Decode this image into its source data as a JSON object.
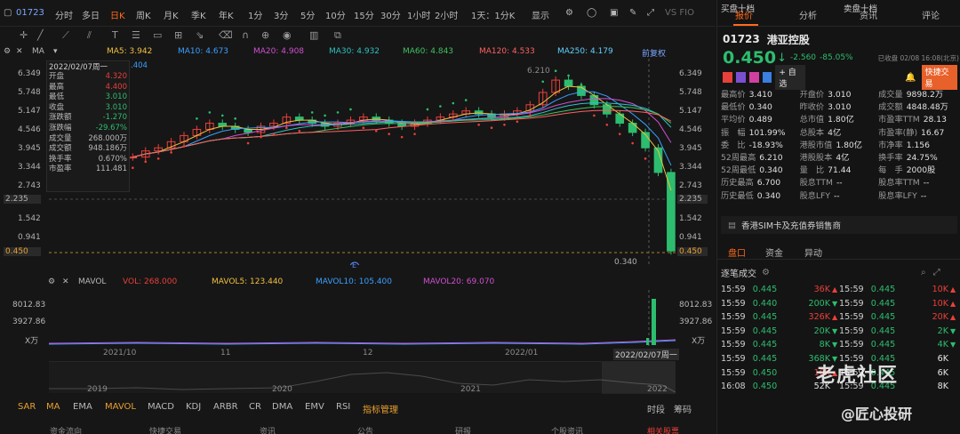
{
  "topbar": {
    "code": "01723",
    "periods": [
      "分时",
      "多日",
      "日K",
      "周K",
      "月K",
      "季K",
      "年K",
      "1分",
      "3分",
      "5分",
      "10分",
      "15分",
      "30分",
      "1小时",
      "2小时"
    ],
    "active_period": "日K",
    "range": "1天：1分K",
    "display": "显示",
    "brand": "VS FIO"
  },
  "ma": {
    "label": "MA",
    "ma5": "MA5: 3.942",
    "ma10": "MA10: 4.673",
    "ma20": "MA20: 4.908",
    "ma30": "MA30: 4.932",
    "ma60": "MA60: 4.843",
    "ma120": "MA120: 4.533",
    "ma250": "MA250: 4.179",
    "adjust": "前复权",
    "overlay_value": ".404"
  },
  "price_axis": [
    "6.349",
    "5.748",
    "5.147",
    "4.546",
    "3.945",
    "3.344",
    "2.743",
    "2.235",
    "1.542",
    "0.941",
    "0.450"
  ],
  "chart_labels": {
    "high": "6.210",
    "low": "0.340",
    "event": "E"
  },
  "infopanel": {
    "date": "2022/02/07周一",
    "rows": [
      {
        "k": "开盘",
        "v": "4.320"
      },
      {
        "k": "最高",
        "v": "4.400"
      },
      {
        "k": "最低",
        "v": "3.010"
      },
      {
        "k": "收盘",
        "v": "3.010"
      },
      {
        "k": "涨跌额",
        "v": "-1.270"
      },
      {
        "k": "涨跌幅",
        "v": "-29.67%"
      },
      {
        "k": "成交量",
        "v": "268.000万"
      },
      {
        "k": "成交额",
        "v": "948.186万"
      },
      {
        "k": "换手率",
        "v": "0.670%"
      },
      {
        "k": "市盈率",
        "v": "111.481"
      }
    ]
  },
  "mavol": {
    "label": "MAVOL",
    "vol": "VOL: 268.000",
    "mavol5": "MAVOL5: 123.440",
    "mavol10": "MAVOL10: 105.400",
    "mavol20": "MAVOL20: 69.070",
    "axis": [
      "8012.83",
      "3927.86",
      "X万"
    ]
  },
  "dates": [
    "2021/10",
    "11",
    "12",
    "2022/01",
    "2022/02/07周一"
  ],
  "years": [
    "2019",
    "2020",
    "2021",
    "2022"
  ],
  "indicators": [
    "SAR",
    "MA",
    "EMA",
    "MAVOL",
    "MACD",
    "KDJ",
    "ARBR",
    "CR",
    "DMA",
    "EMV",
    "RSI",
    "指标管理",
    "时段",
    "筹码"
  ],
  "bottom_tabs": [
    "资金流向",
    "快捷交易",
    "资讯",
    "公告",
    "研报",
    "个股资讯",
    "相关股票"
  ],
  "chart_data": {
    "type": "line",
    "title": "",
    "price_range": [
      0.34,
      6.349
    ],
    "series": [
      {
        "name": "收盘",
        "values": [
          3.5,
          3.7,
          3.8,
          4.0,
          4.2,
          4.4,
          4.6,
          4.5,
          4.4,
          4.3,
          4.5,
          4.6,
          4.8,
          4.7,
          4.6,
          4.5,
          4.6,
          4.7,
          4.8,
          4.7,
          4.6,
          4.5,
          4.6,
          4.7,
          4.8,
          4.9,
          5.0,
          4.9,
          4.8,
          4.9,
          5.0,
          5.2,
          5.6,
          6.0,
          5.8,
          5.5,
          5.2,
          4.9,
          4.6,
          4.3,
          3.8,
          3.0,
          0.45
        ]
      }
    ]
  },
  "right": {
    "tabs": [
      "报价",
      "分析",
      "资讯",
      "评论"
    ],
    "code": "01723",
    "name": "港亚控股",
    "price": "0.450",
    "arrow": "↓",
    "change": "-2.560",
    "change_pct": "-85.05%",
    "close_note": "已收盘 02/08 16:08(北京)",
    "quick_trade": "快捷交易",
    "watch": "自选",
    "stats": [
      [
        {
          "k": "最高价",
          "v": "3.410",
          "c": "red"
        },
        {
          "k": "开盘价",
          "v": "3.010",
          "c": "white"
        },
        {
          "k": "成交量",
          "v": "9898.2万",
          "c": "white"
        }
      ],
      [
        {
          "k": "最低价",
          "v": "0.340",
          "c": "green"
        },
        {
          "k": "昨收价",
          "v": "3.010",
          "c": "white"
        },
        {
          "k": "成交额",
          "v": "4848.48万",
          "c": "white"
        }
      ],
      [
        {
          "k": "平均价",
          "v": "0.489",
          "c": "green"
        },
        {
          "k": "总市值",
          "v": "1.80亿",
          "c": "white"
        },
        {
          "k": "市盈率TTM",
          "v": "28.13",
          "c": "white"
        }
      ],
      [
        {
          "k": "振　幅",
          "v": "101.99%",
          "c": "white"
        },
        {
          "k": "总股本",
          "v": "4亿",
          "c": "white"
        },
        {
          "k": "市盈率(静)",
          "v": "16.67",
          "c": "white"
        }
      ],
      [
        {
          "k": "委　比",
          "v": "-18.93%",
          "c": "white"
        },
        {
          "k": "港股市值",
          "v": "1.80亿",
          "c": "white"
        },
        {
          "k": "市净率",
          "v": "1.156",
          "c": "white"
        }
      ],
      [
        {
          "k": "52周最高",
          "v": "6.210",
          "c": "red"
        },
        {
          "k": "港股股本",
          "v": "4亿",
          "c": "white"
        },
        {
          "k": "换手率",
          "v": "24.75%",
          "c": "white"
        }
      ],
      [
        {
          "k": "52周最低",
          "v": "0.340",
          "c": "green"
        },
        {
          "k": "量　比",
          "v": "71.44",
          "c": "white"
        },
        {
          "k": "每　手",
          "v": "2000股",
          "c": "white"
        }
      ],
      [
        {
          "k": "历史最高",
          "v": "6.700",
          "c": "red"
        },
        {
          "k": "股息TTM",
          "v": "--",
          "c": "white"
        },
        {
          "k": "股息率TTM",
          "v": "--",
          "c": "white"
        }
      ],
      [
        {
          "k": "历史最低",
          "v": "0.340",
          "c": "green"
        },
        {
          "k": "股息LFY",
          "v": "--",
          "c": "white"
        },
        {
          "k": "股息率LFY",
          "v": "--",
          "c": "white"
        }
      ]
    ],
    "promo": "香港SIM卡及充值券销售商",
    "subtabs": [
      "盘口",
      "资金",
      "异动"
    ],
    "ticks_title": "逐笔成交",
    "ticks": [
      [
        {
          "t": "15:59",
          "p": "0.445",
          "v": "36K",
          "c": "red",
          "a": "▲"
        },
        {
          "t": "15:59",
          "p": "0.445",
          "v": "10K",
          "c": "red",
          "a": "▲"
        }
      ],
      [
        {
          "t": "15:59",
          "p": "0.440",
          "v": "200K",
          "c": "green",
          "a": "▼"
        },
        {
          "t": "15:59",
          "p": "0.445",
          "v": "10K",
          "c": "red",
          "a": "▲"
        }
      ],
      [
        {
          "t": "15:59",
          "p": "0.445",
          "v": "326K",
          "c": "red",
          "a": "▲"
        },
        {
          "t": "15:59",
          "p": "0.445",
          "v": "20K",
          "c": "red",
          "a": "▲"
        }
      ],
      [
        {
          "t": "15:59",
          "p": "0.445",
          "v": "20K",
          "c": "green",
          "a": "▼"
        },
        {
          "t": "15:59",
          "p": "0.445",
          "v": "2K",
          "c": "green",
          "a": "▼"
        }
      ],
      [
        {
          "t": "15:59",
          "p": "0.445",
          "v": "8K",
          "c": "green",
          "a": "▼"
        },
        {
          "t": "15:59",
          "p": "0.445",
          "v": "4K",
          "c": "green",
          "a": "▼"
        }
      ],
      [
        {
          "t": "15:59",
          "p": "0.445",
          "v": "368K",
          "c": "green",
          "a": "▼"
        },
        {
          "t": "15:59",
          "p": "0.445",
          "v": "6K",
          "c": "white",
          "a": ""
        }
      ],
      [
        {
          "t": "15:59",
          "p": "0.450",
          "v": "10K",
          "c": "red",
          "a": "▲"
        },
        {
          "t": "15:59",
          "p": "0.445",
          "v": "6K",
          "c": "white",
          "a": ""
        }
      ],
      [
        {
          "t": "16:08",
          "p": "0.450",
          "v": "52K",
          "c": "white",
          "a": ""
        },
        {
          "t": "15:59",
          "p": "0.445",
          "v": "8K",
          "c": "white",
          "a": ""
        }
      ]
    ],
    "buy": "买盘十档",
    "sell": "卖盘十档"
  },
  "watermark": {
    "line1": "老虎社区",
    "line2": "@匠心投研"
  }
}
